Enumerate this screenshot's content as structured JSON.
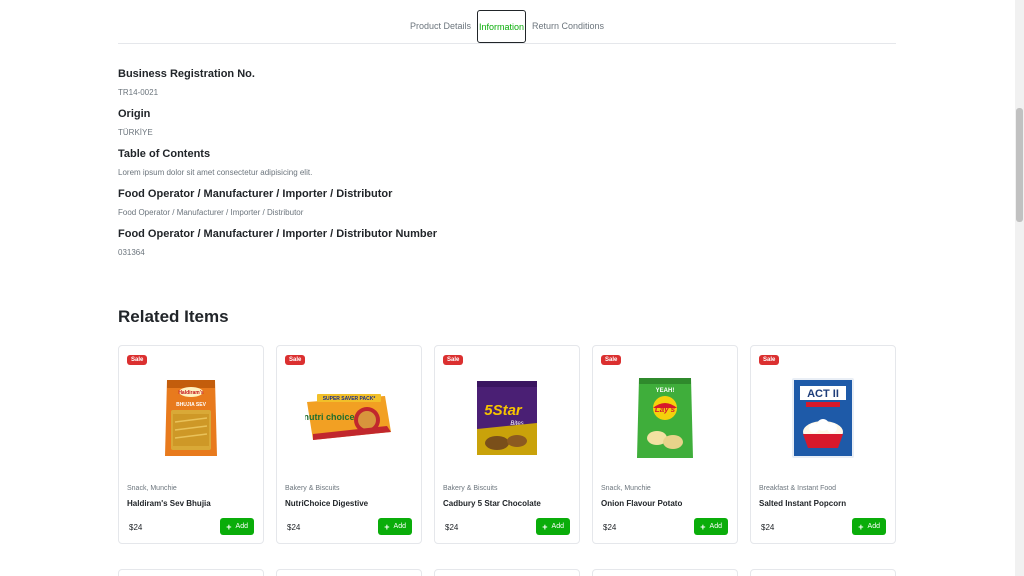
{
  "tabs": [
    {
      "label": "Product Details"
    },
    {
      "label": "Information"
    },
    {
      "label": "Return Conditions"
    }
  ],
  "info": [
    {
      "label": "Business Registration No.",
      "value": "TR14-0021"
    },
    {
      "label": "Origin",
      "value": "TÜRKİYE"
    },
    {
      "label": "Table of Contents",
      "value": "Lorem ipsum dolor sit amet consectetur adipisicing elit."
    },
    {
      "label": "Food Operator / Manufacturer / Importer / Distributor",
      "value": "Food Operator / Manufacturer / Importer / Distributor"
    },
    {
      "label": "Food Operator / Manufacturer / Importer / Distributor Number",
      "value": "031364"
    }
  ],
  "related": {
    "title": "Related Items",
    "items": [
      {
        "badge": "Sale",
        "category": "Snack, Munchie",
        "name": "Haldiram's Sev Bhujia",
        "price": "$24",
        "add_label": "Add"
      },
      {
        "badge": "Sale",
        "category": "Bakery & Biscuits",
        "name": "NutriChoice Digestive",
        "price": "$24",
        "add_label": "Add"
      },
      {
        "badge": "Sale",
        "category": "Bakery & Biscuits",
        "name": "Cadbury 5 Star Chocolate",
        "price": "$24",
        "add_label": "Add"
      },
      {
        "badge": "Sale",
        "category": "Snack, Munchie",
        "name": "Onion Flavour Potato",
        "price": "$24",
        "add_label": "Add"
      },
      {
        "badge": "Sale",
        "category": "Breakfast & Instant Food",
        "name": "Salted Instant Popcorn",
        "price": "$24",
        "add_label": "Add"
      }
    ]
  },
  "images": {
    "item_0": {
      "brand": "Haldiram's",
      "label": "BHUJIA SEV"
    },
    "item_1": {
      "banner": "SUPER SAVER PACK*",
      "brand": "nutri choice"
    },
    "item_2": {
      "brand": "5Star",
      "sub": "Bites"
    },
    "item_3": {
      "brand": "Lay's",
      "banner": "YEAH!"
    },
    "item_4": {
      "brand": "ACT II"
    }
  },
  "colors": {
    "accent": "#0aad0a",
    "sale": "#db3030"
  }
}
